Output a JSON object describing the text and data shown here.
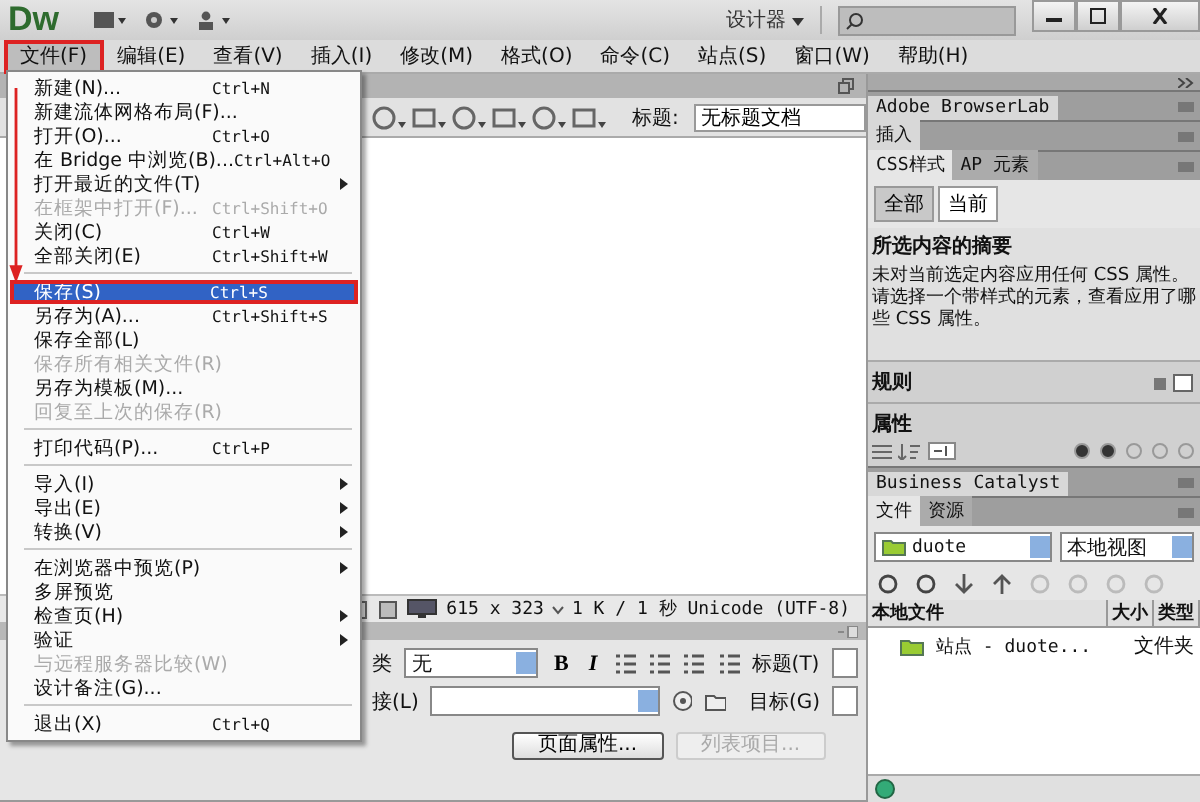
{
  "app": {
    "logo": "Dw",
    "workspace": "设计器"
  },
  "menu_bar": [
    {
      "label": "文件(F)",
      "selected": true
    },
    {
      "label": "编辑(E)",
      "selected": false
    },
    {
      "label": "查看(V)",
      "selected": false
    },
    {
      "label": "插入(I)",
      "selected": false
    },
    {
      "label": "修改(M)",
      "selected": false
    },
    {
      "label": "格式(O)",
      "selected": false
    },
    {
      "label": "命令(C)",
      "selected": false
    },
    {
      "label": "站点(S)",
      "selected": false
    },
    {
      "label": "窗口(W)",
      "selected": false
    },
    {
      "label": "帮助(H)",
      "selected": false
    }
  ],
  "file_menu": [
    {
      "kind": "item",
      "label": "新建(N)...",
      "shortcut": "Ctrl+N",
      "submenu": false,
      "disabled": false,
      "selected": false
    },
    {
      "kind": "item",
      "label": "新建流体网格布局(F)...",
      "submenu": false,
      "disabled": false,
      "selected": false
    },
    {
      "kind": "item",
      "label": "打开(O)...",
      "shortcut": "Ctrl+O",
      "submenu": false,
      "disabled": false,
      "selected": false
    },
    {
      "kind": "item",
      "label": "在 Bridge 中浏览(B)...",
      "shortcut": "Ctrl+Alt+O",
      "submenu": false,
      "disabled": false,
      "selected": false
    },
    {
      "kind": "item",
      "label": "打开最近的文件(T)",
      "submenu": true,
      "disabled": false,
      "selected": false
    },
    {
      "kind": "item",
      "label": "在框架中打开(F)...",
      "shortcut": "Ctrl+Shift+O",
      "submenu": false,
      "disabled": true,
      "selected": false
    },
    {
      "kind": "item",
      "label": "关闭(C)",
      "shortcut": "Ctrl+W",
      "submenu": false,
      "disabled": false,
      "selected": false
    },
    {
      "kind": "item",
      "label": "全部关闭(E)",
      "shortcut": "Ctrl+Shift+W",
      "submenu": false,
      "disabled": false,
      "selected": false
    },
    {
      "kind": "separator"
    },
    {
      "kind": "item",
      "label": "保存(S)",
      "shortcut": "Ctrl+S",
      "submenu": false,
      "disabled": false,
      "selected": true
    },
    {
      "kind": "item",
      "label": "另存为(A)...",
      "shortcut": "Ctrl+Shift+S",
      "submenu": false,
      "disabled": false,
      "selected": false
    },
    {
      "kind": "item",
      "label": "保存全部(L)",
      "submenu": false,
      "disabled": false,
      "selected": false
    },
    {
      "kind": "item",
      "label": "保存所有相关文件(R)",
      "submenu": false,
      "disabled": true,
      "selected": false
    },
    {
      "kind": "item",
      "label": "另存为模板(M)...",
      "submenu": false,
      "disabled": false,
      "selected": false
    },
    {
      "kind": "item",
      "label": "回复至上次的保存(R)",
      "submenu": false,
      "disabled": true,
      "selected": false
    },
    {
      "kind": "separator"
    },
    {
      "kind": "item",
      "label": "打印代码(P)...",
      "shortcut": "Ctrl+P",
      "submenu": false,
      "disabled": false,
      "selected": false
    },
    {
      "kind": "separator"
    },
    {
      "kind": "item",
      "label": "导入(I)",
      "submenu": true,
      "disabled": false,
      "selected": false
    },
    {
      "kind": "item",
      "label": "导出(E)",
      "submenu": true,
      "disabled": false,
      "selected": false
    },
    {
      "kind": "item",
      "label": "转换(V)",
      "submenu": true,
      "disabled": false,
      "selected": false
    },
    {
      "kind": "separator"
    },
    {
      "kind": "item",
      "label": "在浏览器中预览(P)",
      "submenu": true,
      "disabled": false,
      "selected": false
    },
    {
      "kind": "item",
      "label": "多屏预览",
      "submenu": false,
      "disabled": false,
      "selected": false
    },
    {
      "kind": "item",
      "label": "检查页(H)",
      "submenu": true,
      "disabled": false,
      "selected": false
    },
    {
      "kind": "item",
      "label": "验证",
      "submenu": true,
      "disabled": false,
      "selected": false
    },
    {
      "kind": "item",
      "label": "与远程服务器比较(W)",
      "submenu": false,
      "disabled": true,
      "selected": false
    },
    {
      "kind": "item",
      "label": "设计备注(G)...",
      "submenu": false,
      "disabled": false,
      "selected": false
    },
    {
      "kind": "separator"
    },
    {
      "kind": "item",
      "label": "退出(X)",
      "shortcut": "Ctrl+Q",
      "submenu": false,
      "disabled": false,
      "selected": false
    }
  ],
  "document": {
    "title_label": "标题:",
    "title_value": "无标题文档",
    "dimensions": "615 x 323",
    "status_info": "1 K / 1 秒 Unicode (UTF-8)"
  },
  "properties": {
    "class_label": "类",
    "class_value": "无",
    "bold": "B",
    "italic": "I",
    "heading_label": "标题(T)",
    "link_label": "接(L)",
    "target_label": "目标(G)",
    "buttons": [
      {
        "label": "页面属性...",
        "disabled": false
      },
      {
        "label": "列表项目...",
        "disabled": true
      }
    ]
  },
  "side_panel": {
    "headers": [
      "Adobe BrowserLab",
      "插入"
    ],
    "css_tabs": [
      {
        "label": "CSS样式",
        "selected": true
      },
      {
        "label": "AP 元素",
        "selected": false
      }
    ],
    "mode_buttons": [
      {
        "label": "全部",
        "selected": false
      },
      {
        "label": "当前",
        "selected": true
      }
    ],
    "summary_title": "所选内容的摘要",
    "summary_text": "未对当前选定内容应用任何 CSS 属性。请选择一个带样式的元素，查看应用了哪些 CSS 属性。",
    "rules_title": "规则",
    "props_title": "属性",
    "catalyst_header": "Business Catalyst",
    "file_tabs": [
      {
        "label": "文件",
        "selected": true
      },
      {
        "label": "资源",
        "selected": false
      }
    ],
    "site": "duote",
    "view": "本地视图",
    "columns": [
      "本地文件",
      "大小",
      "类型"
    ],
    "rows": [
      {
        "name": "站点 - duote...",
        "size": "",
        "type": "文件夹"
      }
    ]
  }
}
